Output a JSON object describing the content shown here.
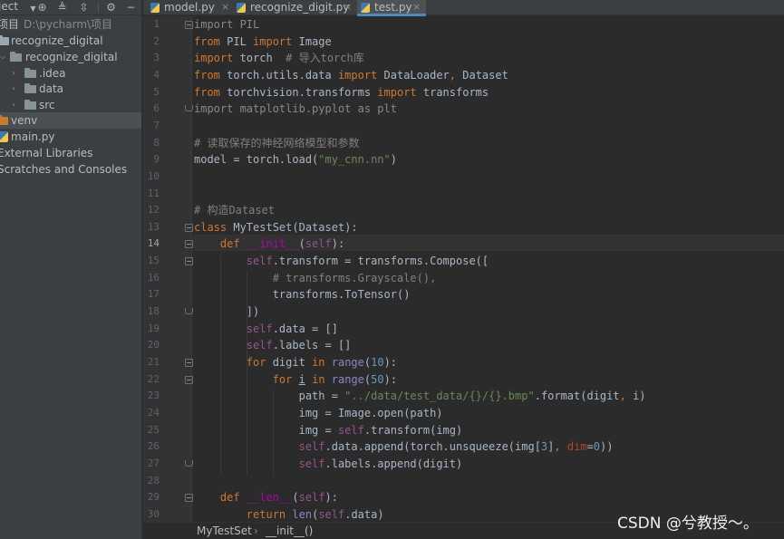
{
  "project_panel": {
    "title": "ject",
    "toolbar_icons": [
      "chevron-down-icon",
      "target-icon",
      "collapse-all-icon",
      "expand-all-icon",
      "gear-icon",
      "minus-icon"
    ],
    "tree": [
      {
        "label": "项目",
        "path": "D:\\pycharm\\项目"
      },
      {
        "label": "recognize_digital"
      },
      {
        "label": "recognize_digital"
      },
      {
        "label": ".idea"
      },
      {
        "label": "data"
      },
      {
        "label": "src"
      },
      {
        "label": "venv"
      },
      {
        "label": "main.py"
      },
      {
        "label": "External Libraries"
      },
      {
        "label": "Scratches and Consoles"
      }
    ]
  },
  "tabs": [
    {
      "label": "model.py",
      "close": "×"
    },
    {
      "label": "recognize_digit.py",
      "close": "×"
    },
    {
      "label": "test.py",
      "close": "×",
      "active": true
    }
  ],
  "editor": {
    "line_numbers": [
      "1",
      "2",
      "3",
      "4",
      "5",
      "6",
      "7",
      "8",
      "9",
      "10",
      "11",
      "12",
      "13",
      "14",
      "15",
      "16",
      "17",
      "18",
      "19",
      "20",
      "21",
      "22",
      "23",
      "24",
      "25",
      "26",
      "27",
      "28",
      "29",
      "30"
    ],
    "current_line": "14",
    "colors": {
      "background": "#2b2b2b",
      "keyword": "#cc7832",
      "string": "#6a8759",
      "comment": "#808080",
      "self": "#94558d",
      "number": "#6897bb",
      "magic": "#b200b2",
      "builtin": "#8888c6"
    }
  },
  "code": {
    "l1": [
      {
        "t": "import PIL",
        "c": "un"
      }
    ],
    "l2": [
      {
        "t": "from",
        "c": "k"
      },
      {
        "t": " PIL "
      },
      {
        "t": "import",
        "c": "k"
      },
      {
        "t": " Image"
      }
    ],
    "l3": [
      {
        "t": "import",
        "c": "k"
      },
      {
        "t": " torch  "
      },
      {
        "t": "# 导入torch库",
        "c": "c"
      }
    ],
    "l4": [
      {
        "t": "from",
        "c": "k"
      },
      {
        "t": " torch.utils.data "
      },
      {
        "t": "import",
        "c": "k"
      },
      {
        "t": " DataLoader"
      },
      {
        "t": ",",
        "c": "k"
      },
      {
        "t": " Dataset"
      }
    ],
    "l5": [
      {
        "t": "from",
        "c": "k"
      },
      {
        "t": " torchvision.transforms "
      },
      {
        "t": "import",
        "c": "k"
      },
      {
        "t": " transforms"
      }
    ],
    "l6": [
      {
        "t": "import matplotlib.pyplot as plt",
        "c": "un"
      }
    ],
    "l7": [],
    "l8": [
      {
        "t": "# 读取保存的神经网络模型和参数",
        "c": "c"
      }
    ],
    "l9": [
      {
        "t": "model = torch.load("
      },
      {
        "t": "\"my_cnn.nn\"",
        "c": "s"
      },
      {
        "t": ")"
      }
    ],
    "l10": [],
    "l11": [],
    "l12": [
      {
        "t": "# 构造Dataset",
        "c": "c"
      }
    ],
    "l13": [
      {
        "t": "class",
        "c": "k"
      },
      {
        "t": " MyTestSet(Dataset):"
      }
    ],
    "l14": [
      {
        "t": "    "
      },
      {
        "t": "def",
        "c": "k"
      },
      {
        "t": " "
      },
      {
        "t": "__init__",
        "c": "mg"
      },
      {
        "t": "("
      },
      {
        "t": "self",
        "c": "self"
      },
      {
        "t": "):"
      }
    ],
    "l15": [
      {
        "t": "        "
      },
      {
        "t": "self",
        "c": "self"
      },
      {
        "t": ".transform = transforms.Compose(["
      }
    ],
    "l16": [
      {
        "t": "            "
      },
      {
        "t": "# transforms.Grayscale(),",
        "c": "c"
      }
    ],
    "l17": [
      {
        "t": "            transforms.ToTensor()"
      }
    ],
    "l18": [
      {
        "t": "        ])"
      }
    ],
    "l19": [
      {
        "t": "        "
      },
      {
        "t": "self",
        "c": "self"
      },
      {
        "t": ".data = []"
      }
    ],
    "l20": [
      {
        "t": "        "
      },
      {
        "t": "self",
        "c": "self"
      },
      {
        "t": ".labels = []"
      }
    ],
    "l21": [
      {
        "t": "        "
      },
      {
        "t": "for",
        "c": "k"
      },
      {
        "t": " digit "
      },
      {
        "t": "in",
        "c": "k"
      },
      {
        "t": " "
      },
      {
        "t": "range",
        "c": "bi"
      },
      {
        "t": "("
      },
      {
        "t": "10",
        "c": "n"
      },
      {
        "t": "):"
      }
    ],
    "l22": [
      {
        "t": "            "
      },
      {
        "t": "for",
        "c": "k"
      },
      {
        "t": " "
      },
      {
        "t": "i",
        "c": "ulv"
      },
      {
        "t": " "
      },
      {
        "t": "in",
        "c": "k"
      },
      {
        "t": " "
      },
      {
        "t": "range",
        "c": "bi"
      },
      {
        "t": "("
      },
      {
        "t": "50",
        "c": "n"
      },
      {
        "t": "):"
      }
    ],
    "l23": [
      {
        "t": "                path = "
      },
      {
        "t": "\"../data/test_data/{}/{}.bmp\"",
        "c": "s"
      },
      {
        "t": ".format(digit"
      },
      {
        "t": ",",
        "c": "k"
      },
      {
        "t": " i)"
      }
    ],
    "l24": [
      {
        "t": "                img = Image.open(path)"
      }
    ],
    "l25": [
      {
        "t": "                img = "
      },
      {
        "t": "self",
        "c": "self"
      },
      {
        "t": ".transform(img)"
      }
    ],
    "l26": [
      {
        "t": "                "
      },
      {
        "t": "self",
        "c": "self"
      },
      {
        "t": ".data.append(torch.unsqueeze(img["
      },
      {
        "t": "3",
        "c": "n"
      },
      {
        "t": "]"
      },
      {
        "t": ",",
        "c": "k"
      },
      {
        "t": " "
      },
      {
        "t": "dim",
        "c": "kw"
      },
      {
        "t": "="
      },
      {
        "t": "0",
        "c": "n"
      },
      {
        "t": "))"
      }
    ],
    "l27": [
      {
        "t": "                "
      },
      {
        "t": "self",
        "c": "self"
      },
      {
        "t": ".labels.append(digit)"
      }
    ],
    "l28": [],
    "l29": [
      {
        "t": "    "
      },
      {
        "t": "def",
        "c": "k"
      },
      {
        "t": " "
      },
      {
        "t": "__len__",
        "c": "mg"
      },
      {
        "t": "("
      },
      {
        "t": "self",
        "c": "self"
      },
      {
        "t": "):"
      }
    ],
    "l30": [
      {
        "t": "        "
      },
      {
        "t": "return",
        "c": "k"
      },
      {
        "t": " "
      },
      {
        "t": "len",
        "c": "bi"
      },
      {
        "t": "("
      },
      {
        "t": "self",
        "c": "self"
      },
      {
        "t": ".data)"
      }
    ]
  },
  "breadcrumb": {
    "class": "MyTestSet",
    "sep": "›",
    "function": "__init__()"
  },
  "watermark": "CSDN @兮教授～。"
}
